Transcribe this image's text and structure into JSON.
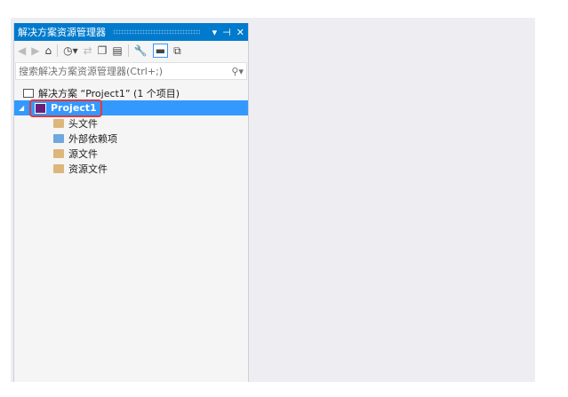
{
  "panel": {
    "title": "解决方案资源管理器",
    "search_placeholder": "搜索解决方案资源管理器(Ctrl+;)"
  },
  "tree": {
    "solution": "解决方案 “Project1” (1 个项目)",
    "project": "Project1",
    "folders": [
      "头文件",
      "外部依赖项",
      "源文件",
      "资源文件"
    ]
  },
  "colors": {
    "accent": "#007acc",
    "selection": "#3399ff",
    "highlight": "#e0393e"
  }
}
